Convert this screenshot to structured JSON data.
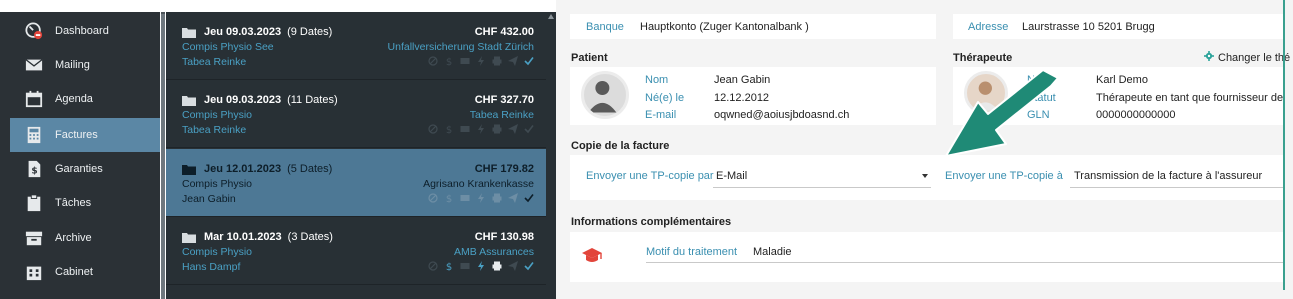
{
  "sidebar": {
    "items": [
      {
        "label": "Dashboard",
        "icon": "dashboard-icon"
      },
      {
        "label": "Mailing",
        "icon": "mail-icon"
      },
      {
        "label": "Agenda",
        "icon": "calendar-icon"
      },
      {
        "label": "Factures",
        "icon": "calculator-icon",
        "active": true
      },
      {
        "label": "Garanties",
        "icon": "dollar-document-icon"
      },
      {
        "label": "Tâches",
        "icon": "clipboard-icon"
      },
      {
        "label": "Archive",
        "icon": "archive-box-icon"
      },
      {
        "label": "Cabinet",
        "icon": "building-icon"
      }
    ]
  },
  "invoices": [
    {
      "date": "Jeu 09.03.2023",
      "count": "(9 Dates)",
      "amount": "CHF 432.00",
      "practice": "Compis Physio See",
      "insurer": "Unfallversicherung Stadt Zürich",
      "therapist": "Tabea Reinke"
    },
    {
      "date": "Jeu 09.03.2023",
      "count": "(11 Dates)",
      "amount": "CHF 327.70",
      "practice": "Compis Physio",
      "insurer": "Tabea Reinke",
      "therapist": "Tabea Reinke"
    },
    {
      "date": "Jeu 12.01.2023",
      "count": "(5 Dates)",
      "amount": "CHF 179.82",
      "practice": "Compis Physio",
      "insurer": "Agrisano Krankenkasse",
      "therapist": "Jean Gabin",
      "selected": true
    },
    {
      "date": "Mar 10.01.2023",
      "count": "(3 Dates)",
      "amount": "CHF 130.98",
      "practice": "Compis Physio",
      "insurer": "AMB Assurances",
      "therapist": "Hans Dampf"
    }
  ],
  "detail": {
    "bank": {
      "label": "Banque",
      "value": "Hauptkonto (Zuger Kantonalbank )"
    },
    "address": {
      "label": "Adresse",
      "value": "Laurstrasse 10 5201 Brugg"
    },
    "patient": {
      "title": "Patient",
      "name_label": "Nom",
      "name": "Jean Gabin",
      "dob_label": "Né(e) le",
      "dob": "12.12.2012",
      "email_label": "E-mail",
      "email": "oqwned@aoiusjbdoasnd.ch"
    },
    "therapist": {
      "title": "Thérapeute",
      "change_label": "Changer le thé",
      "name_label": "Nom",
      "name": "Karl Demo",
      "status_label": "Statut",
      "status": "Thérapeute en tant que fournisseur de p",
      "gln_label": "GLN",
      "gln": "0000000000000"
    },
    "copy": {
      "title": "Copie de la facture",
      "send_by_label": "Envoyer une TP-copie par",
      "send_by_value": "E-Mail",
      "send_to_label": "Envoyer une TP-copie à",
      "send_to_value": "Transmission de la facture à l'assureur"
    },
    "extra": {
      "title": "Informations complémentaires",
      "reason_label": "Motif du traitement",
      "reason_value": "Maladie"
    }
  },
  "colors": {
    "accent": "#3a8fb0",
    "sidebar_bg": "#2b3136",
    "list_bg": "#283035",
    "selected": "#4d7895",
    "arrow": "#1f8a76",
    "badge": "#e2453b"
  }
}
